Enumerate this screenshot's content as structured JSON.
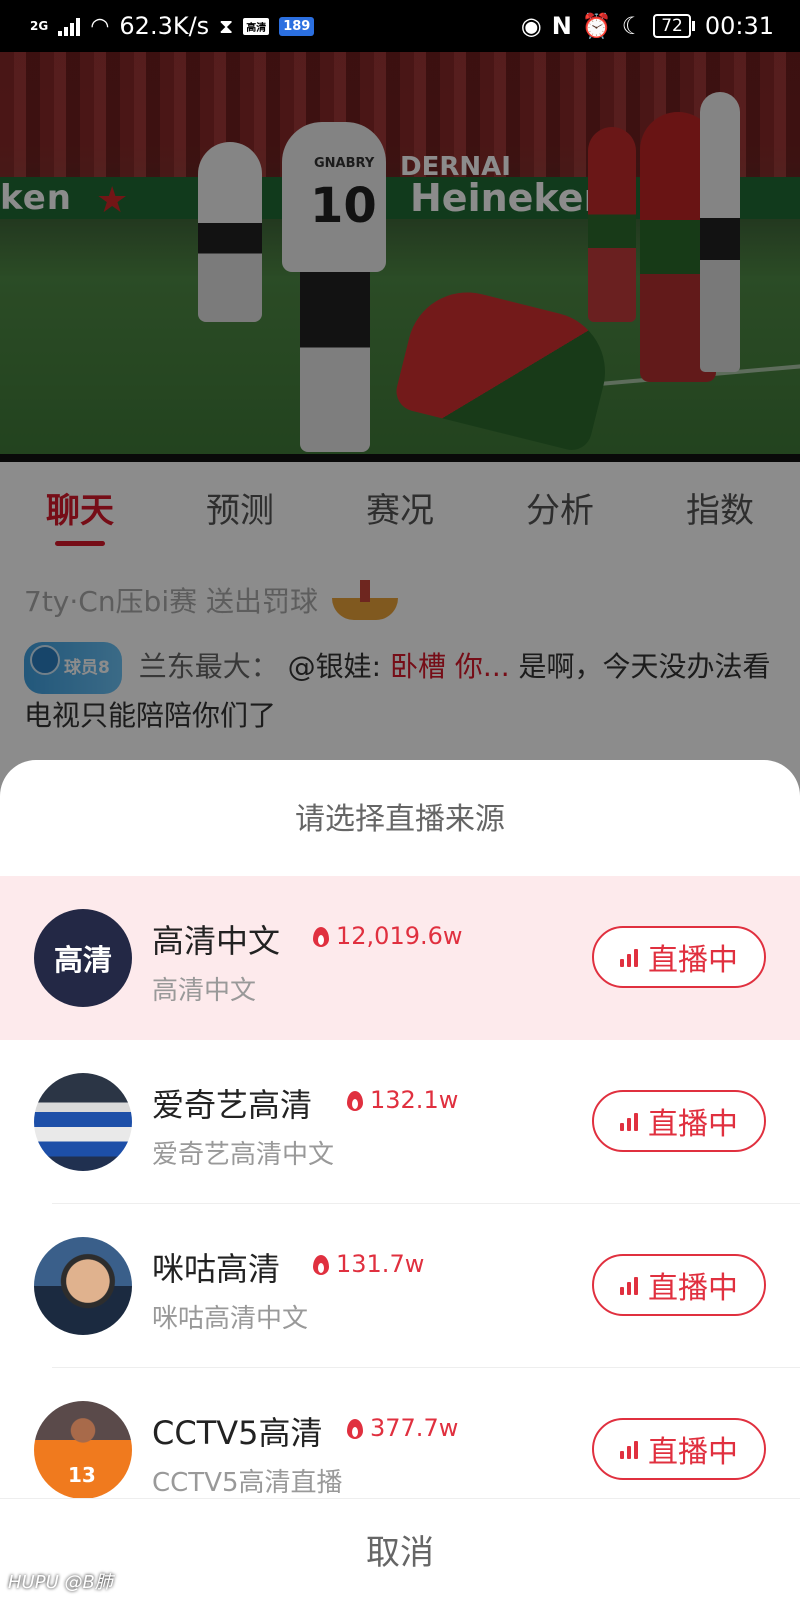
{
  "status_bar": {
    "network_type": "2G",
    "speed": "62.3K/s",
    "badge_hd": "高清",
    "badge_189": "189",
    "battery": "72",
    "time": "00:31",
    "icons": [
      "signal-icon",
      "wifi-icon",
      "hourglass-icon",
      "eye-icon",
      "nfc-icon",
      "alarm-icon",
      "moon-icon",
      "battery-icon"
    ]
  },
  "video": {
    "ad_left": "ken",
    "ad_right": "Heineken",
    "banner": "DERNAI",
    "player_name": "GNABRY",
    "player_number": "10"
  },
  "tabs": [
    {
      "label": "聊天",
      "active": true
    },
    {
      "label": "预测",
      "active": false
    },
    {
      "label": "赛况",
      "active": false
    },
    {
      "label": "分析",
      "active": false
    },
    {
      "label": "指数",
      "active": false
    }
  ],
  "chat": {
    "system_message": "7ty·Cn压bi赛 送出罚球",
    "level_badge": "球员8",
    "user": "兰东最大：",
    "mention": "@银娃:",
    "quote": "卧槽 你...",
    "message": "是啊，今天没办法看电视只能陪陪你们了"
  },
  "sheet": {
    "title": "请选择直播来源",
    "cancel": "取消",
    "sources": [
      {
        "name": "高清中文",
        "heat": "12,019.6w",
        "subtitle": "高清中文",
        "live_label": "直播中",
        "avatar_text": "高清",
        "avatar": "text-avatar"
      },
      {
        "name": "爱奇艺高清",
        "heat": "132.1w",
        "subtitle": "爱奇艺高清中文",
        "live_label": "直播中",
        "avatar": "player-avatar"
      },
      {
        "name": "咪咕高清",
        "heat": "131.7w",
        "subtitle": "咪咕高清中文",
        "live_label": "直播中",
        "avatar": "coach-avatar"
      },
      {
        "name": "CCTV5高清",
        "heat": "377.7w",
        "subtitle": "CCTV5高清直播",
        "live_label": "直播中",
        "avatar": "player-avatar",
        "jersey": "13"
      }
    ]
  },
  "watermark": "HUPU @B肺",
  "colors": {
    "accent": "#e0303f",
    "tab_active": "#d7192a",
    "highlight_row": "#fdeaec"
  }
}
